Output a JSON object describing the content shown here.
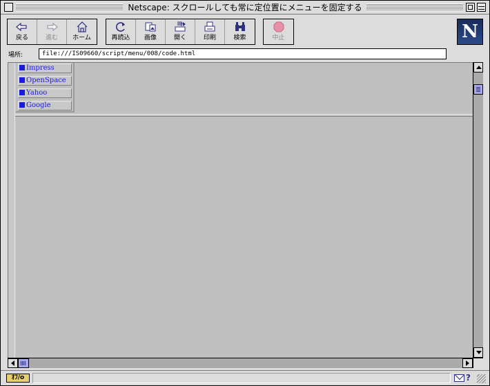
{
  "window": {
    "title": "Netscape: スクロールしても常に定位置にメニューを固定する"
  },
  "toolbar": {
    "back_label": "戻る",
    "forward_label": "進む",
    "home_label": "ホーム",
    "reload_label": "再読込",
    "images_label": "画像",
    "open_label": "開く",
    "print_label": "印刷",
    "find_label": "検索",
    "stop_label": "中止",
    "logo_letter": "N"
  },
  "location": {
    "label": "場所:",
    "url": "file:///IS09660/script/menu/008/code.html"
  },
  "menu": {
    "items": [
      {
        "label": "Impress"
      },
      {
        "label": "OpenSpace"
      },
      {
        "label": "Yahoo"
      },
      {
        "label": "Google"
      }
    ]
  },
  "statusbar": {
    "security_label": "ｵﾌ/o",
    "message": ""
  },
  "colors": {
    "link": "#1a1ae0",
    "content_bg": "#c0c0c0",
    "chrome_bg": "#dcdcdc"
  }
}
